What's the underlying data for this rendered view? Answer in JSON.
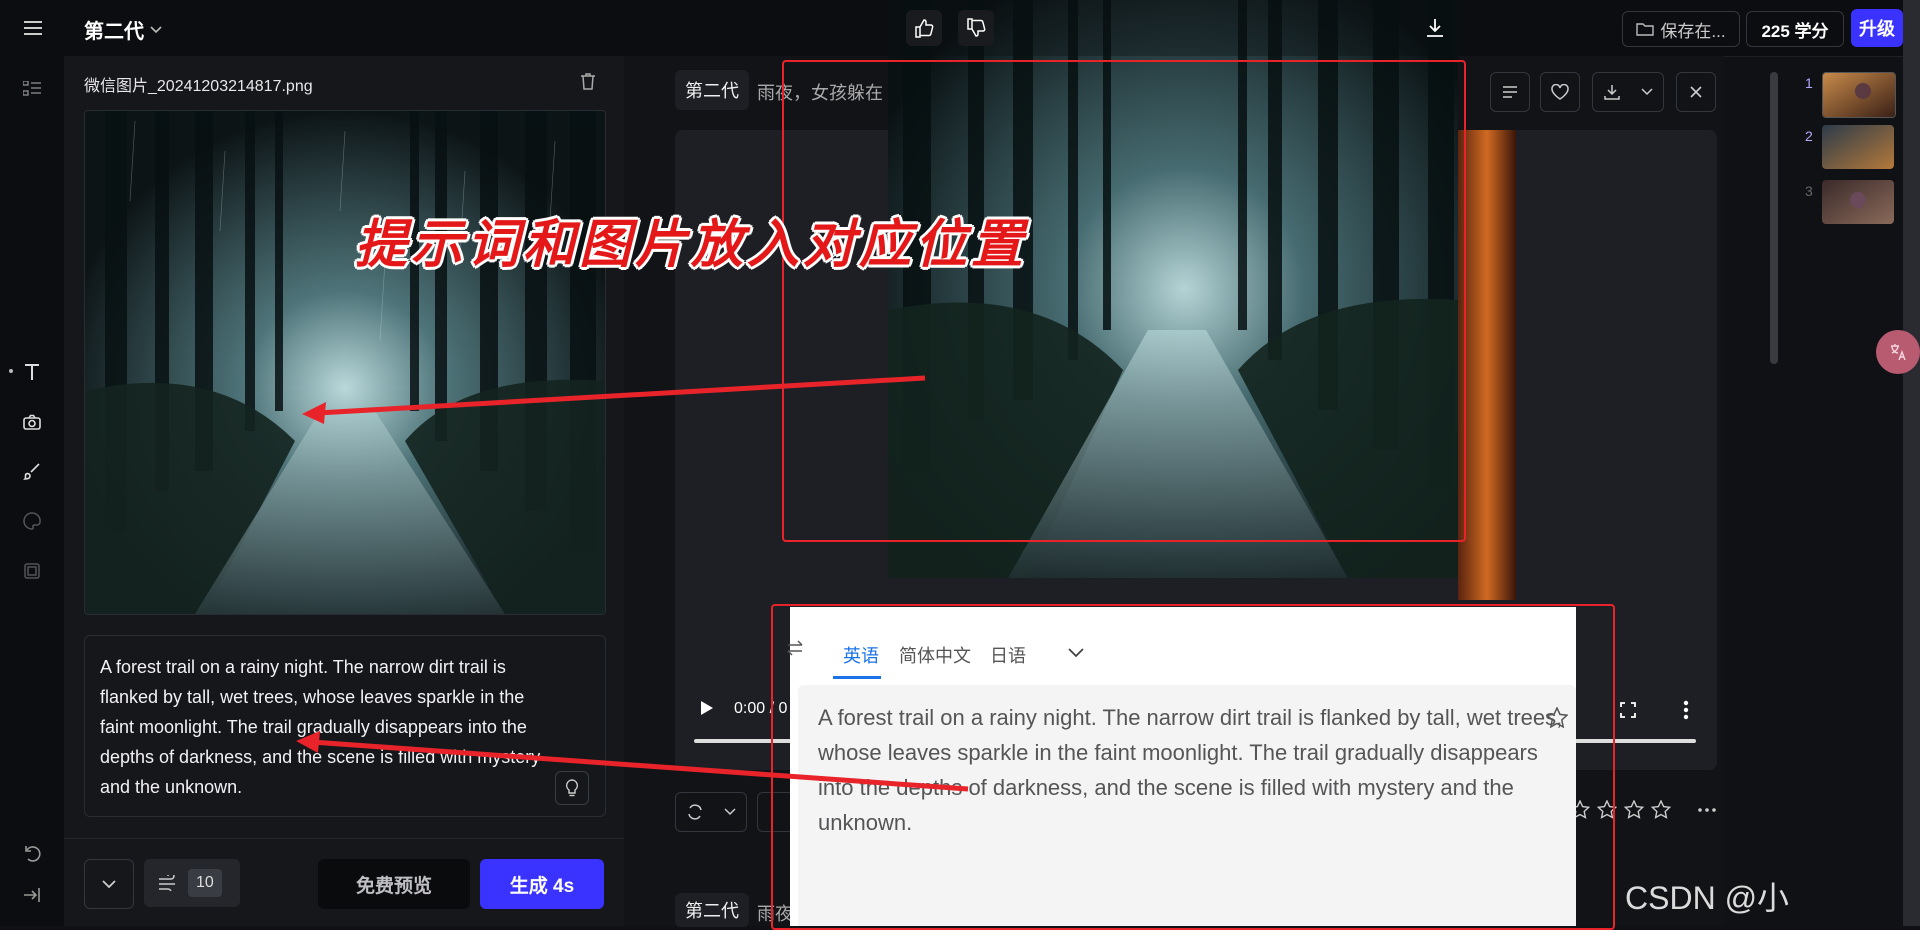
{
  "topbar": {
    "menu_icon": "hamburger-icon",
    "model_label": "第二代",
    "save_label": "保存在...",
    "credits_label": "225 学分",
    "upgrade_label": "升级"
  },
  "left_panel": {
    "file_name": "微信图片_20241203214817.png",
    "prompt": "A forest trail on a rainy night. The narrow dirt trail is flanked by tall, wet trees, whose leaves sparkle in the faint moonlight. The trail gradually disappears into the depths of darkness, and the scene is filled with mystery and the unknown.",
    "count_value": "10",
    "preview_label": "免费预览",
    "generate_label": "生成 4s"
  },
  "main": {
    "model_tag": "第二代",
    "prompt_snippet": "雨夜，女孩躲在",
    "time_label": "0:00 / 0",
    "model_tag_2": "第二代",
    "prompt_snippet_2": "雨夜"
  },
  "translator": {
    "tabs": [
      "英语",
      "简体中文",
      "日语"
    ],
    "text": "A forest trail on a rainy night. The narrow dirt trail is flanked by tall, wet trees, whose leaves sparkle in the faint moonlight. The trail gradually disappears into the depths of darkness, and the scene is filled with mystery and the unknown."
  },
  "annotation": "提示词和图片放入对应位置",
  "thumbnails": [
    {
      "num": "1"
    },
    {
      "num": "2"
    },
    {
      "num": "3"
    }
  ],
  "watermark": "CSDN @小",
  "colors": {
    "accent": "#3a33ff",
    "annotation_red": "#e41818",
    "background": "#101114"
  }
}
